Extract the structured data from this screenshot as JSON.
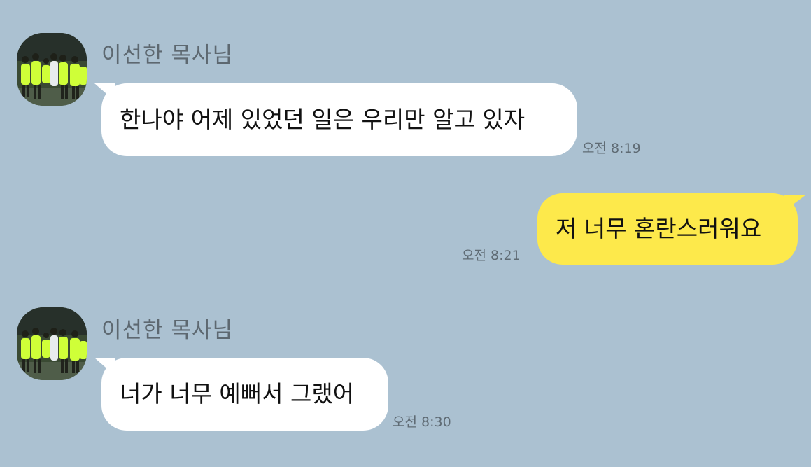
{
  "chat": {
    "messages": [
      {
        "sender": "이선한 목사님",
        "text": "한나야 어제 있었던 일은 우리만 알고 있자",
        "time": "오전 8:19",
        "direction": "incoming"
      },
      {
        "text": "저 너무 혼란스러워요",
        "time": "오전 8:21",
        "direction": "outgoing"
      },
      {
        "sender": "이선한 목사님",
        "text": "너가 너무 예뻐서 그랬어",
        "time": "오전 8:30",
        "direction": "incoming"
      }
    ]
  },
  "colors": {
    "background": "#abc1d1",
    "incoming_bubble": "#ffffff",
    "outgoing_bubble": "#fde94b",
    "timestamp": "#5f6b74",
    "sender_name": "#5d6870"
  }
}
